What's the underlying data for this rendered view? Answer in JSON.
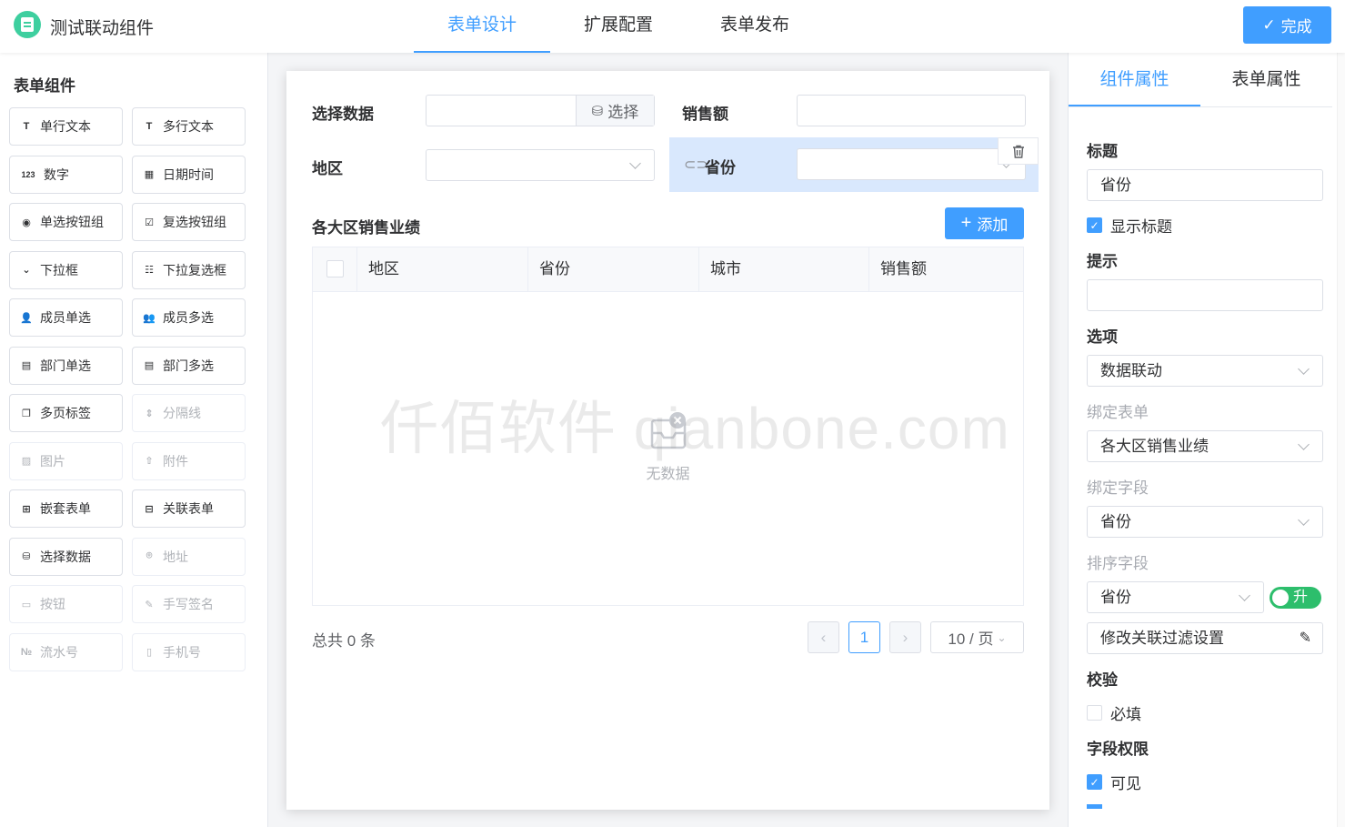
{
  "app": {
    "title": "测试联动组件"
  },
  "top_tabs": [
    {
      "label": "表单设计",
      "active": true
    },
    {
      "label": "扩展配置",
      "active": false
    },
    {
      "label": "表单发布",
      "active": false
    }
  ],
  "finish_label": "完成",
  "palette": {
    "title": "表单组件",
    "items": [
      {
        "label": "单行文本",
        "icon": "text-icon",
        "glyph": "T",
        "disabled": false
      },
      {
        "label": "多行文本",
        "icon": "multiline-text-icon",
        "glyph": "T",
        "disabled": false
      },
      {
        "label": "数字",
        "icon": "number-icon",
        "glyph": "123",
        "disabled": false
      },
      {
        "label": "日期时间",
        "icon": "calendar-icon",
        "glyph": "▦",
        "disabled": false
      },
      {
        "label": "单选按钮组",
        "icon": "radio-icon",
        "glyph": "◉",
        "disabled": false
      },
      {
        "label": "复选按钮组",
        "icon": "checkbox-group-icon",
        "glyph": "☑",
        "disabled": false
      },
      {
        "label": "下拉框",
        "icon": "dropdown-icon",
        "glyph": "⌄",
        "disabled": false
      },
      {
        "label": "下拉复选框",
        "icon": "dropdown-multi-icon",
        "glyph": "☷",
        "disabled": false
      },
      {
        "label": "成员单选",
        "icon": "user-icon",
        "glyph": "👤",
        "disabled": false
      },
      {
        "label": "成员多选",
        "icon": "users-icon",
        "glyph": "👥",
        "disabled": false
      },
      {
        "label": "部门单选",
        "icon": "department-icon",
        "glyph": "▤",
        "disabled": false
      },
      {
        "label": "部门多选",
        "icon": "departments-icon",
        "glyph": "▤",
        "disabled": false
      },
      {
        "label": "多页标签",
        "icon": "tabs-icon",
        "glyph": "❐",
        "disabled": false
      },
      {
        "label": "分隔线",
        "icon": "divider-icon",
        "glyph": "⇕",
        "disabled": true
      },
      {
        "label": "图片",
        "icon": "image-icon",
        "glyph": "▨",
        "disabled": true
      },
      {
        "label": "附件",
        "icon": "upload-icon",
        "glyph": "⇧",
        "disabled": true
      },
      {
        "label": "嵌套表单",
        "icon": "subform-icon",
        "glyph": "⊞",
        "disabled": false
      },
      {
        "label": "关联表单",
        "icon": "linked-form-icon",
        "glyph": "⊟",
        "disabled": false
      },
      {
        "label": "选择数据",
        "icon": "database-icon",
        "glyph": "⛁",
        "disabled": false
      },
      {
        "label": "地址",
        "icon": "location-icon",
        "glyph": "⌾",
        "disabled": true
      },
      {
        "label": "按钮",
        "icon": "button-icon",
        "glyph": "▭",
        "disabled": true
      },
      {
        "label": "手写签名",
        "icon": "signature-icon",
        "glyph": "✎",
        "disabled": true
      },
      {
        "label": "流水号",
        "icon": "serial-number-icon",
        "glyph": "№",
        "disabled": true
      },
      {
        "label": "手机号",
        "icon": "phone-icon",
        "glyph": "▯",
        "disabled": true
      }
    ]
  },
  "form": {
    "select_data_label": "选择数据",
    "select_btn_label": "选择",
    "sales_label": "销售额",
    "region_label": "地区",
    "province_label": "省份",
    "subtable_title": "各大区销售业绩",
    "add_label": "添加",
    "columns": [
      "地区",
      "省份",
      "城市",
      "销售额"
    ],
    "empty_text": "无数据",
    "total_text": "总共 0 条",
    "current_page": "1",
    "page_size": "10 / 页"
  },
  "watermark": "仟佰软件 qianbone.com",
  "props": {
    "tabs": [
      {
        "label": "组件属性",
        "active": true
      },
      {
        "label": "表单属性",
        "active": false
      }
    ],
    "title_label": "标题",
    "title_value": "省份",
    "show_title_label": "显示标题",
    "hint_label": "提示",
    "hint_value": "",
    "options_label": "选项",
    "options_value": "数据联动",
    "bind_form_label": "绑定表单",
    "bind_form_value": "各大区销售业绩",
    "bind_field_label": "绑定字段",
    "bind_field_value": "省份",
    "sort_field_label": "排序字段",
    "sort_field_value": "省份",
    "sort_toggle_label": "升",
    "filter_label": "修改关联过滤设置",
    "validate_label": "校验",
    "required_label": "必填",
    "permission_label": "字段权限",
    "visible_label": "可见"
  },
  "colors": {
    "primary": "#409eff",
    "selected_bg": "#d9e8fd",
    "toggle_on": "#2dbe6c",
    "logo": "#3ecf9f"
  }
}
